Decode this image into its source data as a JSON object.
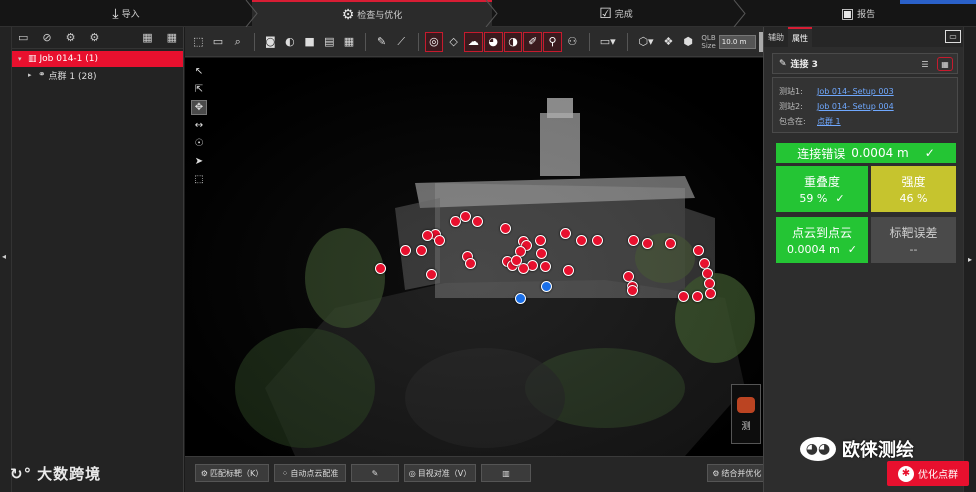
{
  "workflow": {
    "steps": [
      {
        "label": "导入",
        "icon": "⤓"
      },
      {
        "label": "检查与优化",
        "icon": "⚙"
      },
      {
        "label": "完成",
        "icon": "☑"
      },
      {
        "label": "报告",
        "icon": "▣"
      }
    ],
    "active": 1
  },
  "left_panel": {
    "toolbar_icons": [
      "▭",
      "⊘",
      "⚙",
      "⚙",
      "▦",
      "▦"
    ],
    "tree": [
      {
        "label": "Job 014-1 (1)",
        "selected": true
      },
      {
        "label": "点群 1 (28)",
        "selected": false
      }
    ]
  },
  "viewer_toolbar": {
    "qlb_label": "QLB",
    "size_label": "Size",
    "size_value": "10.0 m"
  },
  "viewer": {
    "thumb_label": "测"
  },
  "bottom_bar": {
    "match_targets": "匹配标靶（K）",
    "auto_cloud": "自动点云配准",
    "visual_align": "目视对准（V）",
    "join_optimize": "结合并优化（J）"
  },
  "right_panel": {
    "tabs": [
      "辅助",
      "属性"
    ],
    "active_tab": 1,
    "link_title": "连接 3",
    "stations": [
      {
        "key": "测站1:",
        "value": "Job 014- Setup 003"
      },
      {
        "key": "测站2:",
        "value": "Job 014- Setup 004"
      },
      {
        "key": "包含在:",
        "value": "点群 1"
      }
    ],
    "link_error": {
      "label": "连接错误",
      "value": "0.0004 m",
      "check": "✓"
    },
    "overlap": {
      "label": "重叠度",
      "value": "59 %",
      "check": "✓"
    },
    "strength": {
      "label": "强度",
      "value": "46 %"
    },
    "cloud_to_cloud": {
      "label": "点云到点云",
      "value": "0.0004 m",
      "check": "✓"
    },
    "target_error": {
      "label": "标靶误差",
      "value": "--"
    }
  },
  "watermark": {
    "left": "大数跨境",
    "left_logo": "↻°",
    "right": "欧徕测绘"
  },
  "optimize_button": "优化点群",
  "colors": {
    "accent_red": "#e8102e",
    "good_green": "#24c534",
    "warn_yellow": "#c6c42e"
  }
}
